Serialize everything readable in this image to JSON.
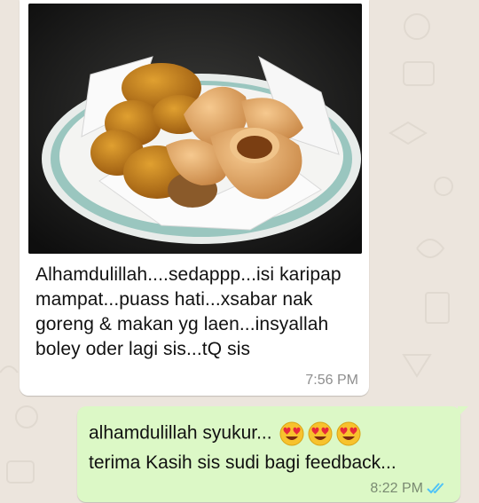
{
  "incoming": {
    "image_alt": "plate of fried karipap curry puffs",
    "text": "Alhamdulillah....sedappp...isi karipap mampat...puass hati...xsabar nak goreng & makan yg laen...insyallah boley oder lagi sis...tQ sis",
    "time": "7:56 PM"
  },
  "outgoing": {
    "line1": "alhamdulillah syukur...",
    "line1_emojis": [
      "smiling-face-with-heart-eyes-icon",
      "smiling-face-with-heart-eyes-icon",
      "smiling-face-with-heart-eyes-icon"
    ],
    "line2": "terima Kasih sis sudi bagi feedback...",
    "time": "8:22 PM",
    "status": "read-double-tick-icon"
  },
  "colors": {
    "chat_background": "#ece5dd",
    "incoming_bubble": "#ffffff",
    "outgoing_bubble": "#dcf8c6",
    "read_tick": "#4fc3f7"
  }
}
